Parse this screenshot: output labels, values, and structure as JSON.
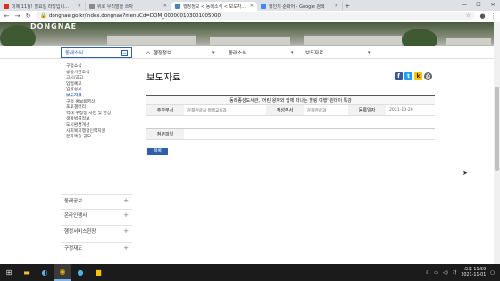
{
  "browser": {
    "tabs": [
      {
        "title": "이제 11월! 월요일 라방입니...",
        "fav": "#d93025",
        "icon": "youtube-icon"
      },
      {
        "title": "위로 우리말을 쓰자",
        "fav": "#888888",
        "icon": "page-icon"
      },
      {
        "title": "행정정보 < 동래소식 < 보도자...",
        "fav": "#4a7fc1",
        "icon": "site-icon"
      },
      {
        "title": "행인지 순화어 - Google 검색",
        "fav": "#4285f4",
        "icon": "google-icon"
      }
    ],
    "newtab": "+",
    "url": "dongnae.go.kr/index.dongnae?menuCd=DOM_000000103001005000",
    "lock": "🔒"
  },
  "hero": {
    "text": "DONGNAE"
  },
  "sidebar": {
    "header": "동래소식",
    "items": [
      "구정소식",
      "공공기관소식",
      "고시/공고",
      "입법예고",
      "입찰공고",
      "보도자료",
      "구정 홍보동영상",
      "포토갤러리",
      "역대 구청장 사진 및 영상",
      "생활법률정보",
      "도시환경개선",
      "사회복지행정인력지원",
      "문화예술 공모"
    ],
    "active_index": 5,
    "categories": [
      "동래공보",
      "온라인행사",
      "행정서비스헌장",
      "구정재도"
    ]
  },
  "breadcrumb": {
    "home": "⌂",
    "c1": "행정정보",
    "c2": "동래소식",
    "c3": "보도자료"
  },
  "page": {
    "title": "보도자료",
    "article_title": "동래종성도서관, '어린 왕자와 함께 떠나는 힐링 여행' 원데이 특강",
    "dept_label": "주관부서",
    "dept_value": "문화관광국 평생교육과",
    "writer_label": "작성부서",
    "writer_value": "문화관광과",
    "date_label": "등록일자",
    "date_value": "2021-10-20",
    "attach_label": "첨부파일",
    "list_button": "목록"
  },
  "share": {
    "facebook": "f",
    "twitter": "t",
    "kakao": "k",
    "print": "⎙"
  },
  "taskbar": {
    "time": "오후 11:59",
    "date": "2021-11-01",
    "ime": "가",
    "moon": "☾"
  },
  "colors": {
    "accent": "#2e5fa8"
  }
}
